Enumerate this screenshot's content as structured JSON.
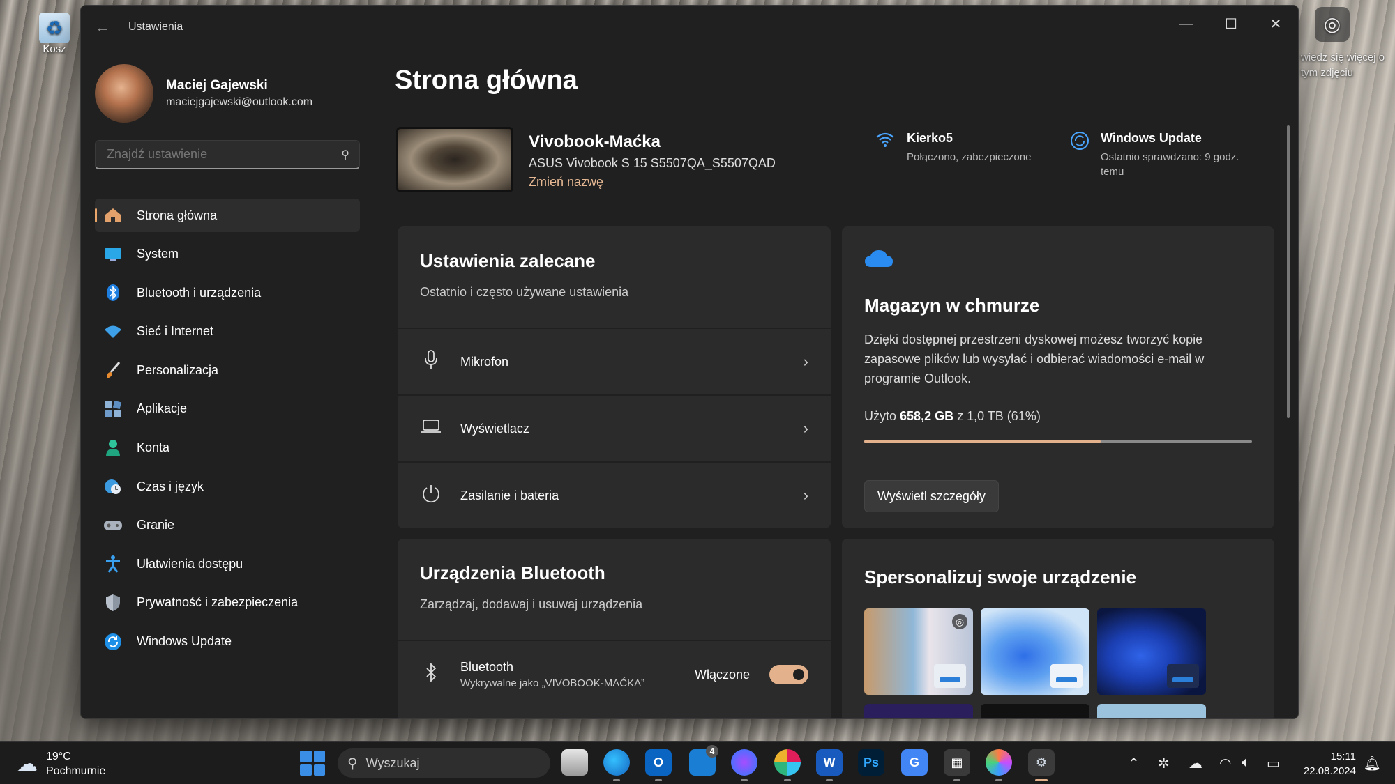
{
  "desktop": {
    "recycle_label": "Kosz",
    "spotlight_text": "wiedz się więcej o tym zdjęciu"
  },
  "window": {
    "title": "Ustawienia",
    "controls": [
      "minimize",
      "maximize",
      "close"
    ]
  },
  "profile": {
    "name": "Maciej Gajewski",
    "email": "maciejgajewski@outlook.com"
  },
  "search": {
    "placeholder": "Znajdź ustawienie"
  },
  "nav": {
    "items": [
      {
        "label": "Strona główna",
        "icon": "home-icon",
        "active": true
      },
      {
        "label": "System",
        "icon": "monitor-icon"
      },
      {
        "label": "Bluetooth i urządzenia",
        "icon": "bluetooth-icon"
      },
      {
        "label": "Sieć i Internet",
        "icon": "wifi-icon"
      },
      {
        "label": "Personalizacja",
        "icon": "brush-icon"
      },
      {
        "label": "Aplikacje",
        "icon": "apps-icon"
      },
      {
        "label": "Konta",
        "icon": "person-icon"
      },
      {
        "label": "Czas i język",
        "icon": "globe-clock-icon"
      },
      {
        "label": "Granie",
        "icon": "gamepad-icon"
      },
      {
        "label": "Ułatwienia dostępu",
        "icon": "accessibility-icon"
      },
      {
        "label": "Prywatność i zabezpieczenia",
        "icon": "shield-icon"
      },
      {
        "label": "Windows Update",
        "icon": "update-icon"
      }
    ]
  },
  "main": {
    "title": "Strona główna",
    "device": {
      "name": "Vivobook-Maćka",
      "model": "ASUS Vivobook S 15 S5507QA_S5507QAD",
      "rename": "Zmień nazwę"
    },
    "wifi": {
      "name": "Kierko5",
      "status": "Połączono, zabezpieczone"
    },
    "update": {
      "title": "Windows Update",
      "status": "Ostatnio sprawdzano: 9 godz. temu"
    },
    "recommended": {
      "title": "Ustawienia zalecane",
      "subtitle": "Ostatnio i często używane ustawienia",
      "rows": [
        {
          "label": "Mikrofon",
          "icon": "microphone-icon"
        },
        {
          "label": "Wyświetlacz",
          "icon": "laptop-icon"
        },
        {
          "label": "Zasilanie i bateria",
          "icon": "power-icon"
        }
      ]
    },
    "cloud": {
      "title": "Magazyn w chmurze",
      "description": "Dzięki dostępnej przestrzeni dyskowej możesz tworzyć kopie zapasowe plików lub wysyłać i odbierać wiadomości e-mail w programie Outlook.",
      "used_prefix": "Użyto",
      "used_value": "658,2 GB",
      "used_suffix": "z 1,0 TB (61%)",
      "used_fraction": 0.61,
      "button": "Wyświetl szczegóły"
    },
    "bluetooth": {
      "title": "Urządzenia Bluetooth",
      "subtitle": "Zarządzaj, dodawaj i usuwaj urządzenia",
      "row_title": "Bluetooth",
      "row_sub": "Wykrywalne jako „VIVOBOOK-MAĆKA”",
      "state": "Włączone",
      "enabled": true
    },
    "personalize": {
      "title": "Spersonalizuj swoje urządzenie"
    }
  },
  "taskbar": {
    "temperature": "19°C",
    "condition": "Pochmurnie",
    "search_placeholder": "Wyszukaj",
    "outlook_badge": "4",
    "time": "15:11",
    "date": "22.08.2024"
  }
}
